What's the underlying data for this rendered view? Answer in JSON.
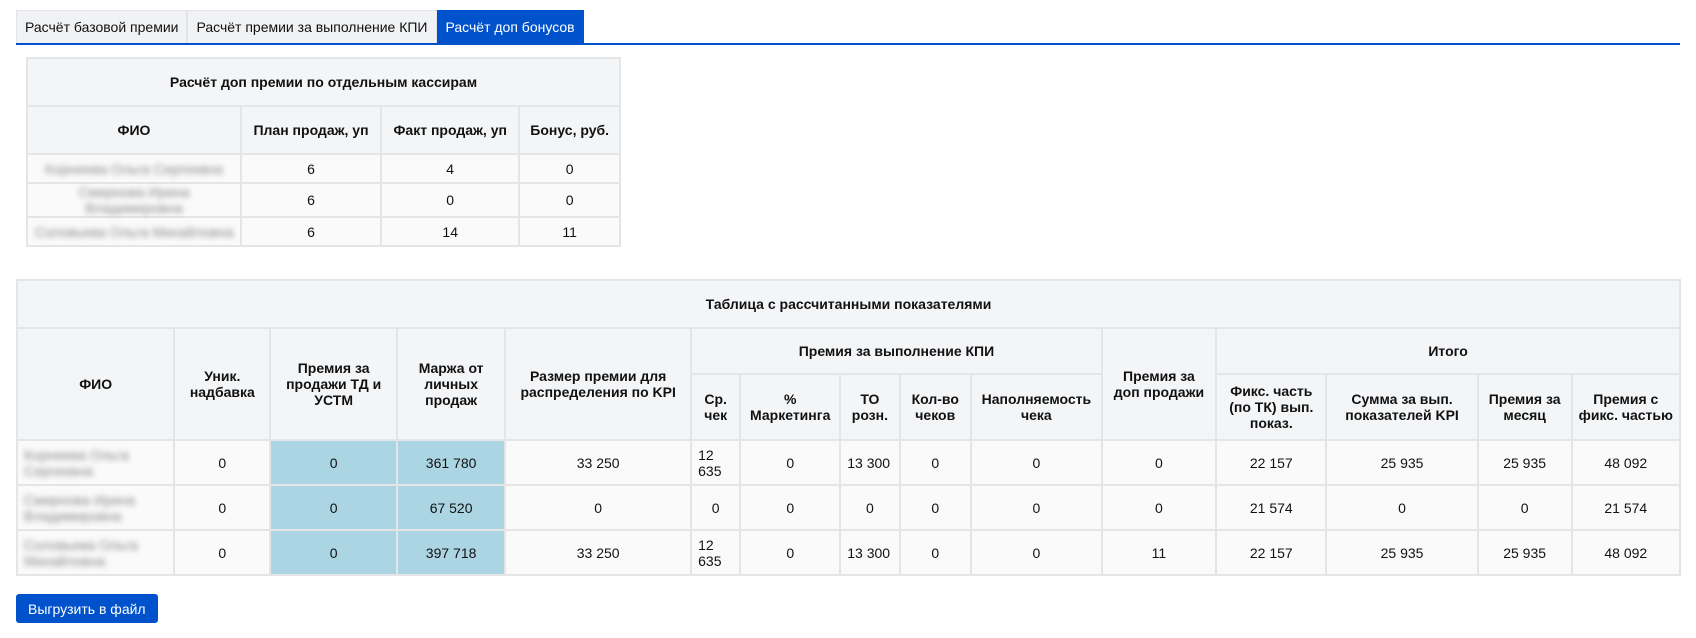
{
  "tabs": [
    {
      "label": "Расчёт базовой премии",
      "active": false
    },
    {
      "label": "Расчёт премии за выполнение КПИ",
      "active": false
    },
    {
      "label": "Расчёт доп бонусов",
      "active": true
    }
  ],
  "cashier_table": {
    "title": "Расчёт доп премии по отдельным кассирам",
    "headers": [
      "ФИО",
      "План продаж, уп",
      "Факт продаж, уп",
      "Бонус, руб."
    ],
    "rows": [
      {
        "name": "Корнеева Ольга Сергеевна",
        "plan": "6",
        "fact": "4",
        "bonus": "0"
      },
      {
        "name": "Смирнова Ирина Владимировна",
        "plan": "6",
        "fact": "0",
        "bonus": "0"
      },
      {
        "name": "Соловьева Ольга Михайловна",
        "plan": "6",
        "fact": "14",
        "bonus": "11"
      }
    ]
  },
  "main_table": {
    "title": "Таблица с рассчитанными показателями",
    "headers": {
      "fio": "ФИО",
      "unik": "Уник. надбавка",
      "premia_td": "Премия за продажи ТД и УСТМ",
      "marzha": "Маржа от личных продаж",
      "razmer": "Размер премии для распределения по KPI",
      "kpi_group": "Премия за выполнение КПИ",
      "kpi_sr": "Ср. чек",
      "kpi_mark": "% Маркетинга",
      "kpi_to": "ТО розн.",
      "kpi_kol": "Кол-во чеков",
      "kpi_nap": "Наполняемость чека",
      "dop": "Премия за доп продажи",
      "itogo_group": "Итого",
      "fiks": "Фикс. часть (по ТК) вып. показ.",
      "summa": "Сумма за вып. показателей KPI",
      "mesyac": "Премия за месяц",
      "s_fiks": "Премия с фикс. частью"
    },
    "rows": [
      {
        "name": "Корнеева Ольга Сергеевна",
        "unik": "0",
        "premia_td": "0",
        "marzha": "361 780",
        "razmer": "33 250",
        "sr": "12 635",
        "mark": "0",
        "to": "13 300",
        "kol": "0",
        "nap": "0",
        "dop": "0",
        "fiks": "22 157",
        "summa": "25 935",
        "mesyac": "25 935",
        "s_fiks": "48 092"
      },
      {
        "name": "Смирнова Ирина Владимировна",
        "unik": "0",
        "premia_td": "0",
        "marzha": "67 520",
        "razmer": "0",
        "sr": "0",
        "mark": "0",
        "to": "0",
        "kol": "0",
        "nap": "0",
        "dop": "0",
        "fiks": "21 574",
        "summa": "0",
        "mesyac": "0",
        "s_fiks": "21 574"
      },
      {
        "name": "Соловьева Ольга Михайловна",
        "unik": "0",
        "premia_td": "0",
        "marzha": "397 718",
        "razmer": "33 250",
        "sr": "12 635",
        "mark": "0",
        "to": "13 300",
        "kol": "0",
        "nap": "0",
        "dop": "11",
        "fiks": "22 157",
        "summa": "25 935",
        "mesyac": "25 935",
        "s_fiks": "48 092"
      }
    ]
  },
  "export_button": "Выгрузить в файл"
}
